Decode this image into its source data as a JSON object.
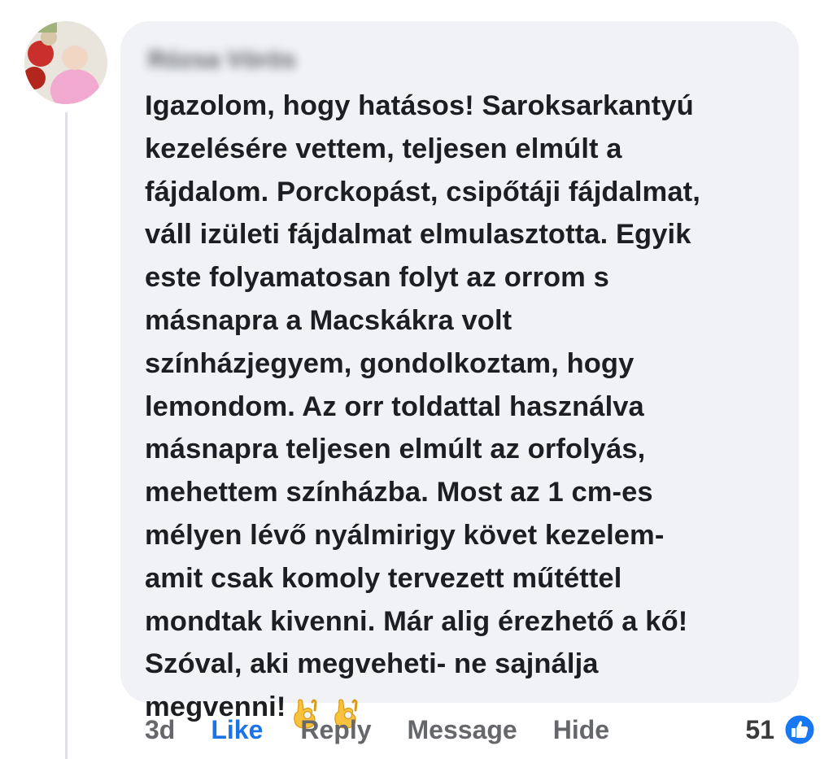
{
  "comment": {
    "author": "Rózsa Vörös",
    "lines": [
      "Igazolom, hogy hatásos! Saroksarkantyú",
      "kezelésére vettem, teljesen elmúlt a",
      "fájdalom. Porckopást, csipőtáji fájdalmat,",
      "váll izületi fájdalmat elmulasztotta. Egyik",
      "este folyamatosan folyt az orrom s",
      "másnapra a Macskákra volt",
      "színházjegyem, gondolkoztam, hogy",
      "lemondom. Az orr toldattal használva",
      "másnapra teljesen elmúlt az orfolyás,",
      "mehettem színházba. Most az 1 cm-es",
      "mélyen lévő nyálmirigy követ kezelem-",
      "amit csak komoly tervezett műtéttel",
      "mondtak kivenni. Már alig érezhető a kő!",
      "Szóval, aki megveheti- ne sajnálja"
    ],
    "last_line": "megvenni!",
    "emojis": [
      "ok-hand-icon",
      "ok-hand-icon"
    ]
  },
  "actions": {
    "time": "3d",
    "like": "Like",
    "reply": "Reply",
    "message": "Message",
    "hide": "Hide"
  },
  "reactions": {
    "count": "51",
    "icon": "thumbs-up-icon"
  },
  "colors": {
    "bubble": "#f0f2f5",
    "like_active": "#1a73e8",
    "action_gray": "#65676b",
    "badge_blue": "#1877f2"
  }
}
